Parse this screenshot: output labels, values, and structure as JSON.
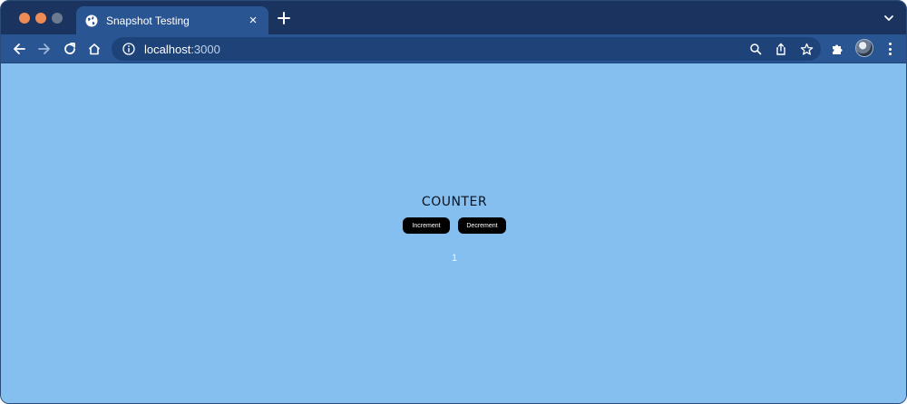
{
  "browser": {
    "tab": {
      "title": "Snapshot Testing",
      "icon": "globe-icon",
      "close_icon": "close-icon"
    },
    "new_tab_icon": "plus-icon",
    "tab_menu_icon": "chevron-down-icon",
    "toolbar": {
      "back_icon": "arrow-left-icon",
      "forward_icon": "arrow-right-icon",
      "reload_icon": "reload-icon",
      "home_icon": "home-icon",
      "url_host": "localhost",
      "url_port": ":3000",
      "site_info_icon": "info-icon",
      "zoom_icon": "search-icon",
      "share_icon": "share-icon",
      "bookmark_icon": "star-icon",
      "extensions_icon": "puzzle-icon",
      "profile_icon": "avatar",
      "menu_icon": "kebab-icon"
    },
    "colors": {
      "frame": "#1a335f",
      "toolbar": "#2a5593",
      "omnibox": "#1e4378"
    }
  },
  "page": {
    "heading": "COUNTER",
    "increment_label": "Increment",
    "decrement_label": "Decrement",
    "count": "1",
    "colors": {
      "background": "#85bff0",
      "button": "#000000"
    }
  }
}
